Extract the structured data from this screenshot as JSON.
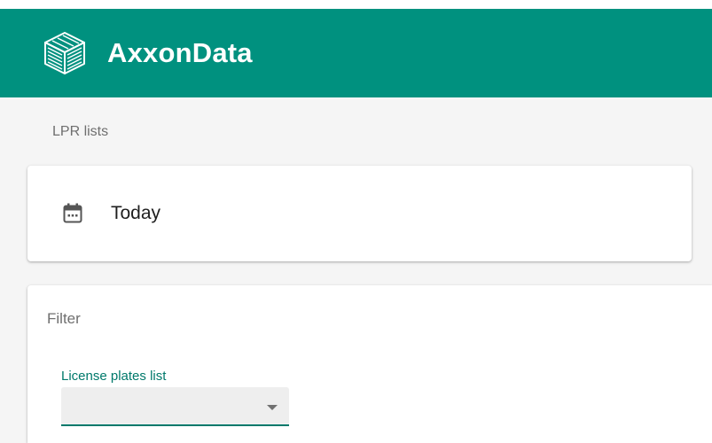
{
  "app": {
    "title": "AxxonData",
    "logo_icon": "stacked-layers-cube-icon",
    "brand_color": "#00917f"
  },
  "page": {
    "section_title": "LPR lists"
  },
  "date_card": {
    "icon": "calendar-icon",
    "label": "Today"
  },
  "filter": {
    "title": "Filter",
    "license_plates_list": {
      "label": "License plates list",
      "selected_value": "",
      "accent_color": "#00796b"
    }
  }
}
